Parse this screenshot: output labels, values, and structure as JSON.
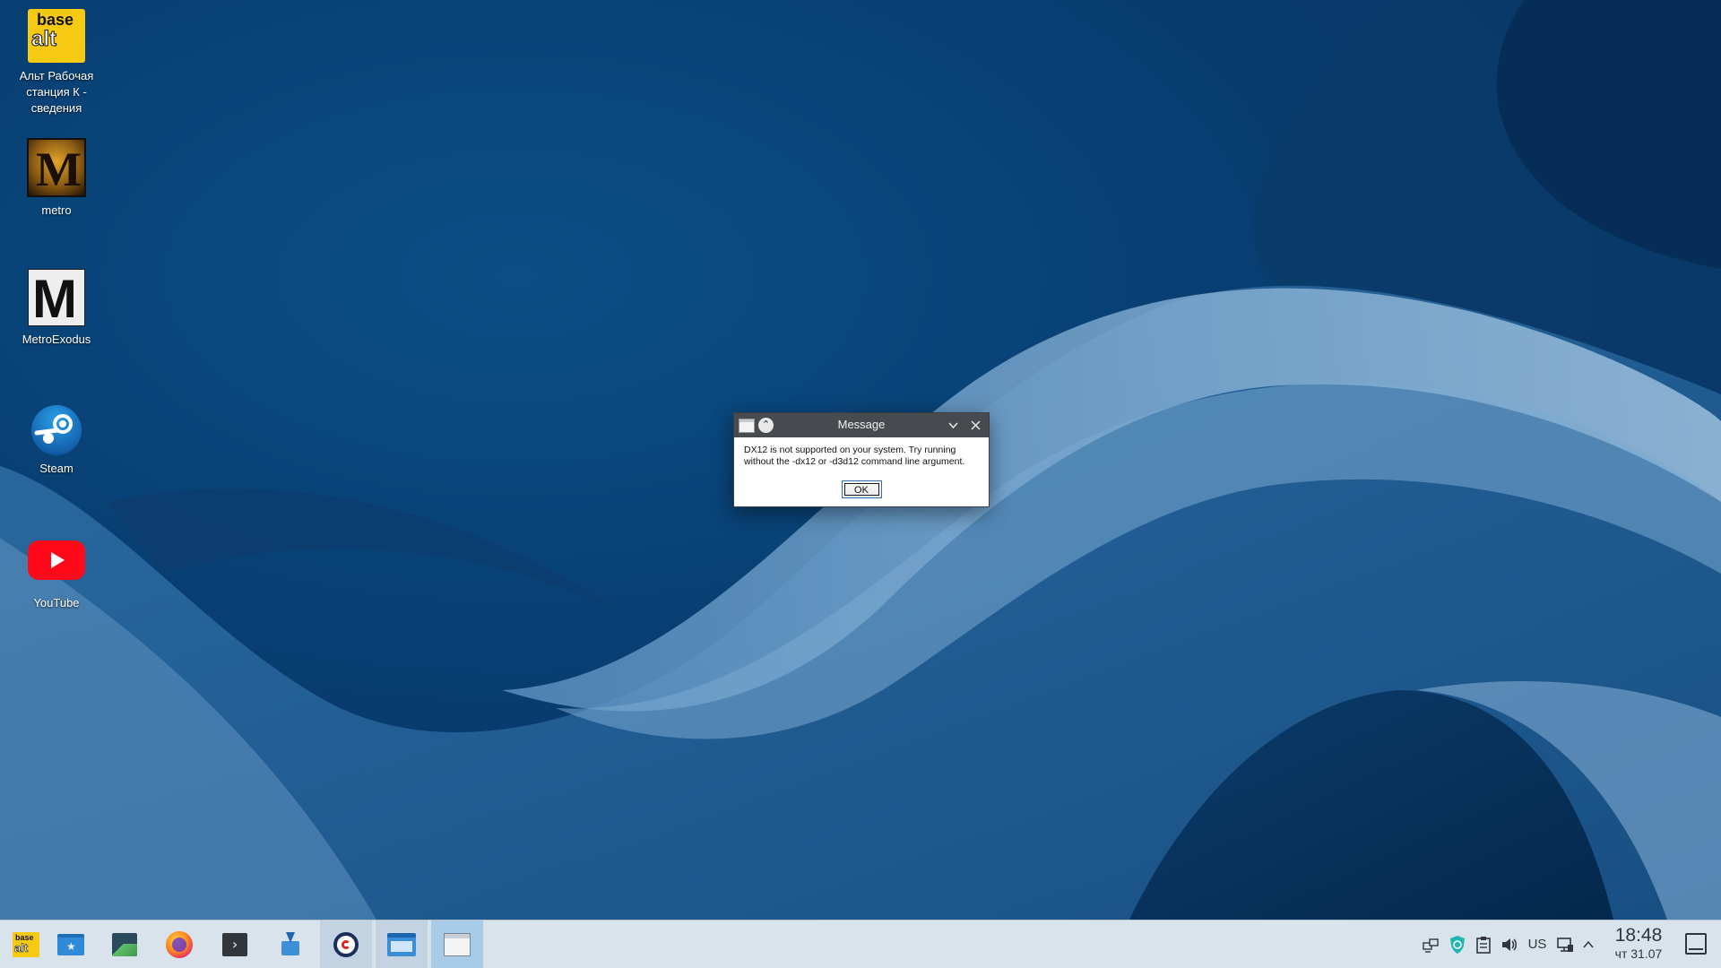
{
  "desktop": {
    "icons": [
      {
        "name": "basealt",
        "label": "Альт Рабочая станция К  - сведения",
        "icon": "basealt-logo-icon"
      },
      {
        "name": "metro",
        "label": "metro",
        "icon": "metro-game-icon"
      },
      {
        "name": "metro-exodus",
        "label": "MetroExodus",
        "icon": "metro-exodus-icon"
      },
      {
        "name": "steam",
        "label": "Steam",
        "icon": "steam-icon"
      },
      {
        "name": "youtube",
        "label": "YouTube",
        "icon": "youtube-icon"
      }
    ],
    "basealt_logo_top": "base",
    "basealt_logo_bottom": "alt",
    "metro_letter": "M"
  },
  "dialog": {
    "title": "Message",
    "message": "DX12 is not supported on your system. Try running without the -dx12 or -d3d12 command line argument.",
    "ok_label": "OK"
  },
  "taskbar": {
    "items": [
      {
        "name": "application-launcher",
        "icon": "basealt-logo-icon",
        "state": "normal"
      },
      {
        "name": "home-folder",
        "icon": "folder-star-icon",
        "state": "normal"
      },
      {
        "name": "system-monitor",
        "icon": "system-monitor-icon",
        "state": "normal"
      },
      {
        "name": "firefox",
        "icon": "firefox-icon",
        "state": "normal"
      },
      {
        "name": "terminal",
        "icon": "terminal-icon",
        "state": "normal"
      },
      {
        "name": "software-center",
        "icon": "discover-icon",
        "state": "normal"
      },
      {
        "name": "game-launcher",
        "icon": "circle-app-icon",
        "state": "active"
      },
      {
        "name": "file-manager",
        "icon": "file-manager-icon",
        "state": "active"
      },
      {
        "name": "message-window",
        "icon": "window-icon",
        "state": "current"
      }
    ],
    "launcher_text_top": "base",
    "launcher_text_bottom": "alt",
    "terminal_glyph": "›",
    "tray": {
      "keyboard_layout": "US",
      "time": "18:48",
      "date": "чт 31.07"
    }
  }
}
